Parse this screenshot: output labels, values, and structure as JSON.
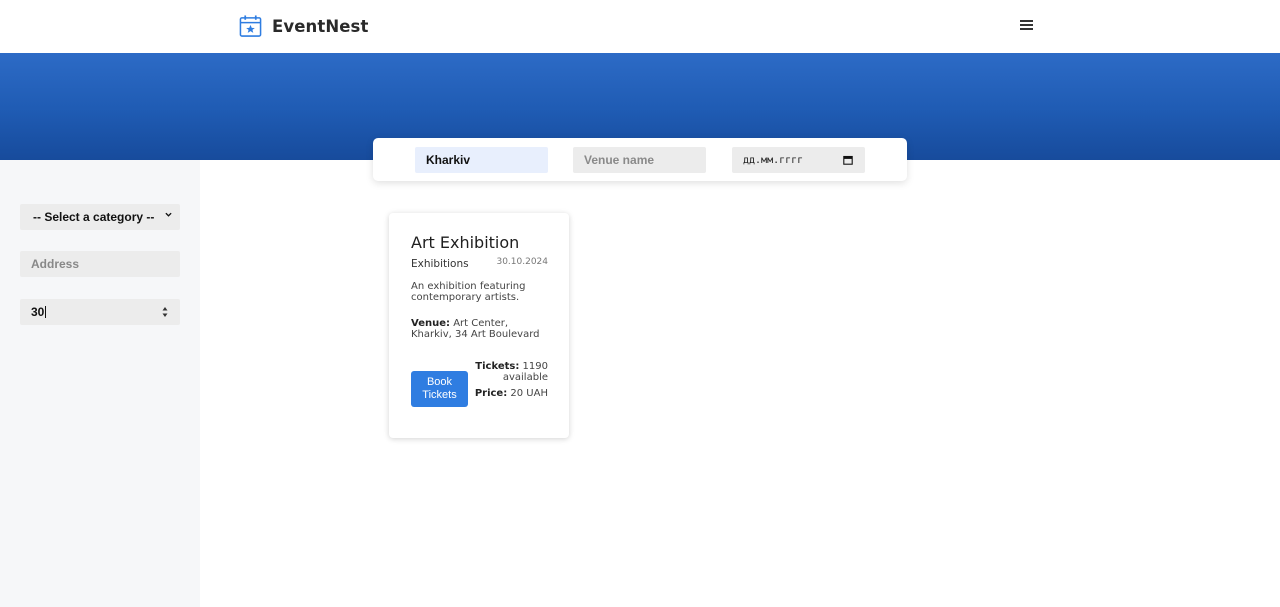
{
  "header": {
    "brand_name": "EventNest",
    "brand_icon": "calendar-star-icon",
    "menu_icon": "hamburger-menu-icon"
  },
  "colors": {
    "hero_top": "#2d6bc6",
    "hero_bottom": "#174b9c",
    "accent": "#2f7de1",
    "sidebar_bg": "#f6f7f9"
  },
  "filters": {
    "category": {
      "selected": "-- Select a category --"
    },
    "address": {
      "placeholder": "Address",
      "value": ""
    },
    "tickets": {
      "value": "30"
    }
  },
  "search": {
    "city": {
      "value": "Kharkiv"
    },
    "venue": {
      "placeholder": "Venue name",
      "value": ""
    },
    "date": {
      "placeholder": "дд.мм.гггг"
    }
  },
  "events": [
    {
      "title": "Art Exhibition",
      "category": "Exhibitions",
      "date": "30.10.2024",
      "description": "An exhibition featuring contemporary artists.",
      "venue_label": "Venue:",
      "venue": "Art Center, Kharkiv, 34 Art Boulevard",
      "book_label": "Book Tickets",
      "tickets_label": "Tickets:",
      "tickets": "1190 available",
      "price_label": "Price:",
      "price": "20 UAH"
    }
  ]
}
